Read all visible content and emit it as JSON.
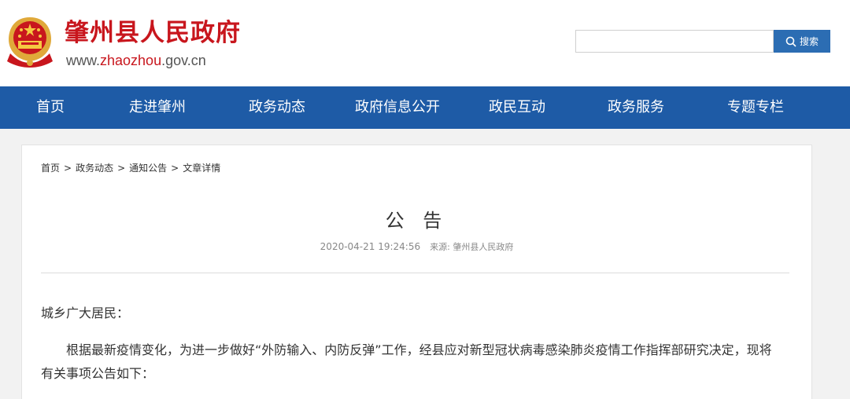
{
  "header": {
    "site_title": "肇州县人民政府",
    "url_prefix": "www.",
    "url_domain": "zhaozhou",
    "url_suffix": ".gov.cn",
    "emblem_icon": "national-emblem-icon"
  },
  "search": {
    "placeholder": "",
    "value": "",
    "button_label": "搜索",
    "icon": "search-icon"
  },
  "nav": {
    "items": [
      "首页",
      "走进肇州",
      "政务动态",
      "政府信息公开",
      "政民互动",
      "政务服务",
      "专题专栏"
    ]
  },
  "breadcrumb": {
    "items": [
      "首页",
      "政务动态",
      "通知公告",
      "文章详情"
    ],
    "separator": ">"
  },
  "article": {
    "title": "公 告",
    "datetime": "2020-04-21 19:24:56",
    "source": "来源: 肇州县人民政府",
    "salutation": "城乡广大居民：",
    "paragraph1": "根据最新疫情变化，为进一步做好“外防输入、内防反弹”工作，经县应对新型冠状病毒感染肺炎疫情工作指挥部研究决定，现将有关事项公告如下："
  },
  "colors": {
    "brand_red": "#c8161d",
    "nav_blue": "#1e5ba6",
    "button_blue": "#2c6db3"
  }
}
